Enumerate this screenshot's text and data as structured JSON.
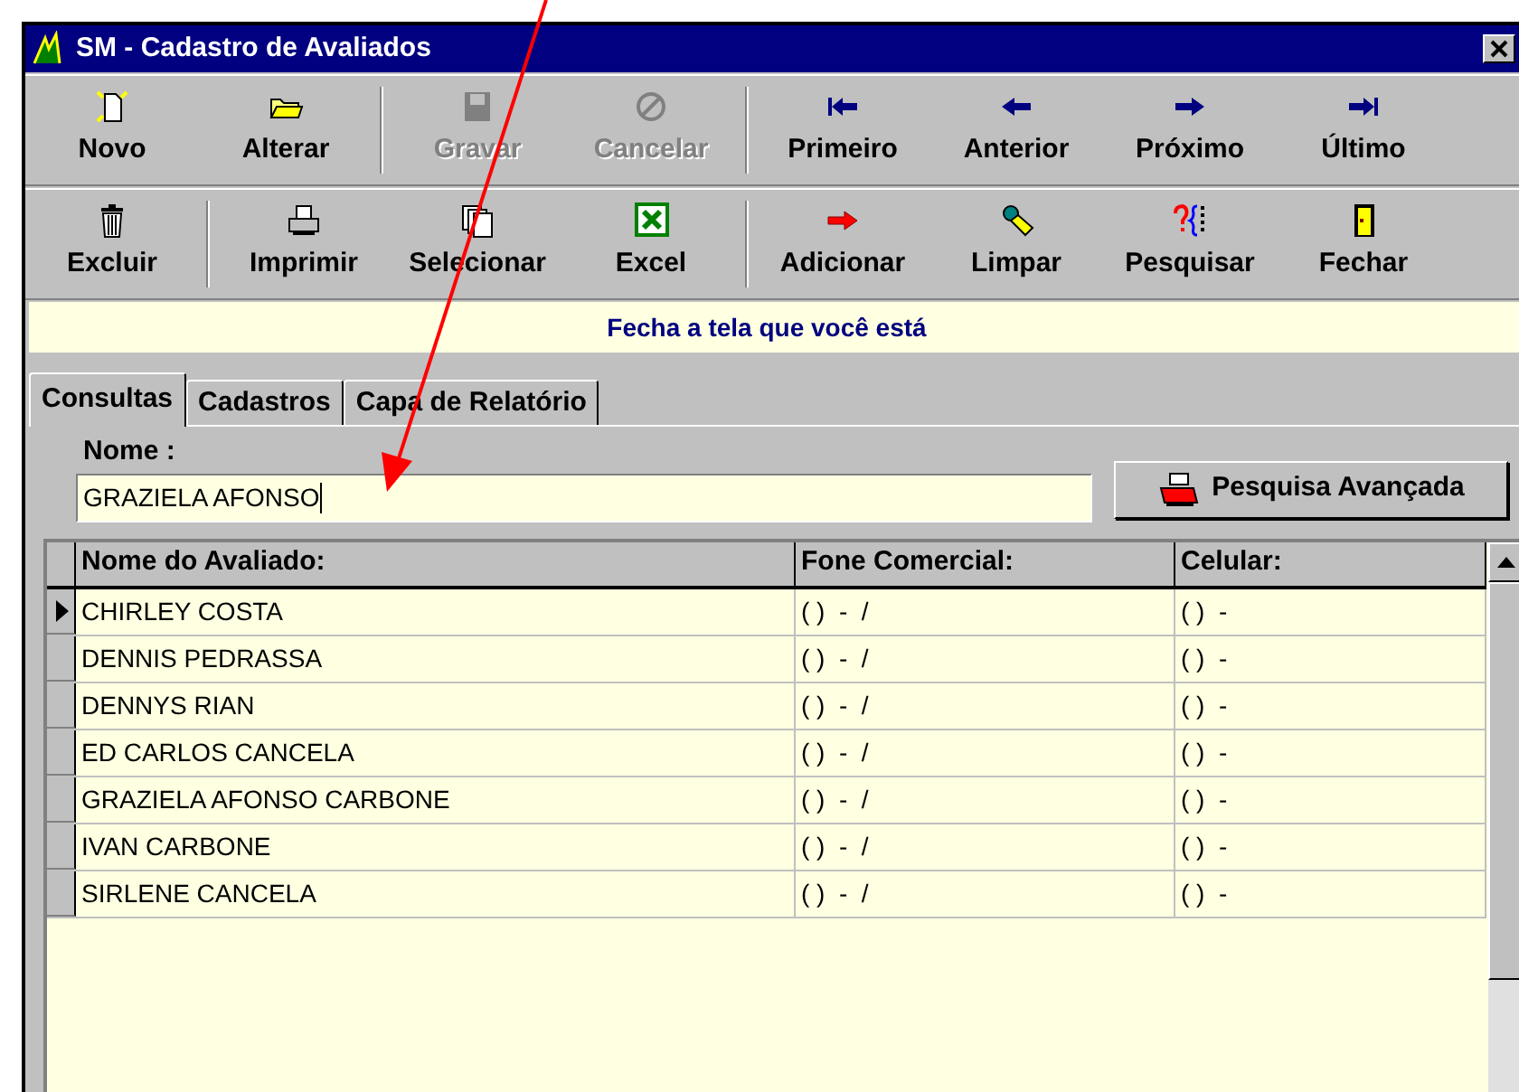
{
  "window": {
    "title": "SM - Cadastro de Avaliados"
  },
  "toolbars": [
    [
      [
        {
          "label": "Novo",
          "kind": "new",
          "disabled": false
        },
        {
          "label": "Alterar",
          "kind": "folder",
          "disabled": false
        }
      ],
      [
        {
          "label": "Gravar",
          "kind": "save",
          "disabled": true
        },
        {
          "label": "Cancelar",
          "kind": "cancel",
          "disabled": true
        }
      ],
      [
        {
          "label": "Primeiro",
          "kind": "first",
          "disabled": false
        },
        {
          "label": "Anterior",
          "kind": "prev",
          "disabled": false
        },
        {
          "label": "Próximo",
          "kind": "next",
          "disabled": false
        },
        {
          "label": "Último",
          "kind": "last",
          "disabled": false
        }
      ]
    ],
    [
      [
        {
          "label": "Excluir",
          "kind": "trash",
          "disabled": false
        }
      ],
      [
        {
          "label": "Imprimir",
          "kind": "print",
          "disabled": false
        },
        {
          "label": "Selecionar",
          "kind": "pages",
          "disabled": false
        },
        {
          "label": "Excel",
          "kind": "excel",
          "disabled": false
        }
      ],
      [
        {
          "label": "Adicionar",
          "kind": "add",
          "disabled": false
        },
        {
          "label": "Limpar",
          "kind": "clear",
          "disabled": false
        },
        {
          "label": "Pesquisar",
          "kind": "search",
          "disabled": false
        },
        {
          "label": "Fechar",
          "kind": "door",
          "disabled": false
        }
      ]
    ]
  ],
  "hint": "Fecha a tela que você está",
  "tabs": [
    {
      "label": "Consultas",
      "selected": true
    },
    {
      "label": "Cadastros",
      "selected": false
    },
    {
      "label": "Capa de Relatório",
      "selected": false
    }
  ],
  "search": {
    "label": "Nome :",
    "value": "GRAZIELA AFONSO",
    "button": "Pesquisa Avançada"
  },
  "table": {
    "columns": [
      "Nome do Avaliado:",
      "Fone Comercial:",
      "Celular:"
    ],
    "rows": [
      {
        "cells": [
          "CHIRLEY COSTA",
          "( )  -  /",
          "( )  -"
        ],
        "selected": true
      },
      {
        "cells": [
          "DENNIS PEDRASSA",
          "( )  -  /",
          "( )  -"
        ],
        "selected": false
      },
      {
        "cells": [
          "DENNYS RIAN",
          "( )  -  /",
          "( )  -"
        ],
        "selected": false
      },
      {
        "cells": [
          "ED CARLOS CANCELA",
          "( )  -  /",
          "( )  -"
        ],
        "selected": false
      },
      {
        "cells": [
          "GRAZIELA AFONSO CARBONE",
          "( )  -  /",
          "( )  -"
        ],
        "selected": false
      },
      {
        "cells": [
          "IVAN CARBONE",
          "( )  -  /",
          "( )  -"
        ],
        "selected": false
      },
      {
        "cells": [
          "SIRLENE CANCELA",
          "( )  -  /",
          "( )  -"
        ],
        "selected": false
      }
    ]
  }
}
